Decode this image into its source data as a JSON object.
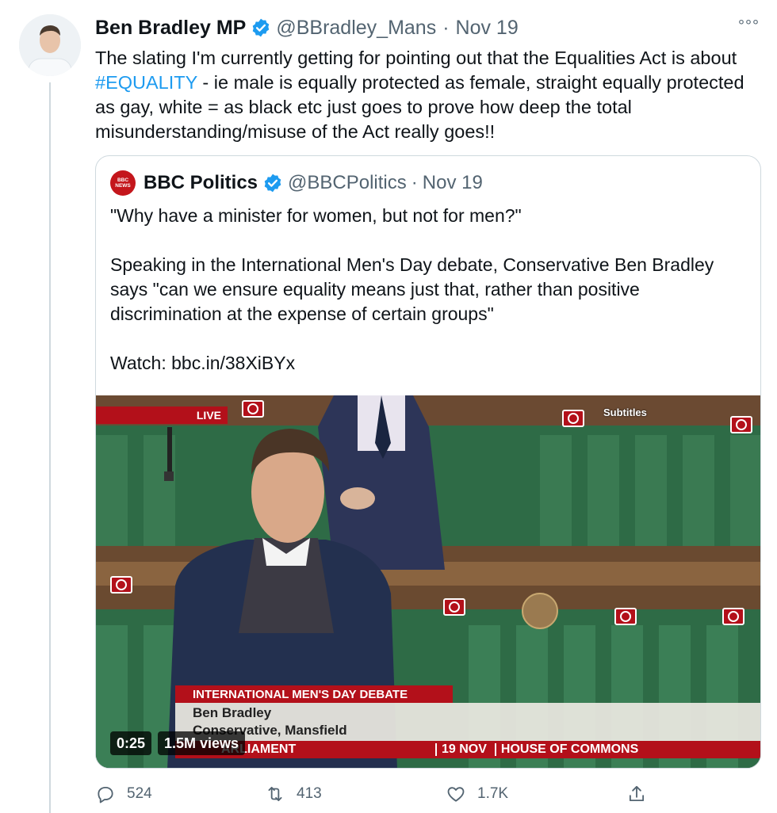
{
  "tweet": {
    "author_name": "Ben Bradley MP",
    "handle": "@BBradley_Mans",
    "separator": "·",
    "date": "Nov 19",
    "more": "°°°",
    "text_before": "The slating I'm currently getting for pointing out that the Equalities Act is about ",
    "hashtag": "#EQUALITY",
    "text_after": " - ie male is equally protected as female, straight equally protected as gay, white = as black etc just goes to prove how deep the total misunderstanding/misuse of the Act really goes!!"
  },
  "quote": {
    "author_name": "BBC Politics",
    "handle": "@BBCPolitics",
    "separator": "·",
    "date": "Nov 19",
    "logo_line1": "BBC",
    "logo_line2": "NEWS",
    "line1": "\"Why have a minister for women, but not for men?\"",
    "line2": "Speaking in the International Men's Day debate, Conservative Ben Bradley says \"can we ensure equality means just that, rather than positive discrimination at the expense of certain groups\"",
    "line3": "Watch: bbc.in/38XiBYx"
  },
  "video": {
    "live_label": "LIVE",
    "subtitles_label": "Subtitles",
    "banner": "INTERNATIONAL MEN'S DAY DEBATE",
    "speaker": "Ben Bradley",
    "speaker_role": "Conservative, Mansfield",
    "channel": "ARLIAMENT",
    "strip_date": "19 NOV",
    "strip_place": "HOUSE OF COMMONS",
    "duration": "0:25",
    "views": "1.5M views"
  },
  "actions": {
    "replies": "524",
    "retweets": "413",
    "likes": "1.7K"
  },
  "colors": {
    "link": "#1d9bf0",
    "verified": "#1d9bf0",
    "bbc_red": "#b3101a",
    "muted": "#536471"
  },
  "icons": [
    "verified-icon",
    "more-icon",
    "reply-icon",
    "retweet-icon",
    "like-icon",
    "share-icon"
  ]
}
